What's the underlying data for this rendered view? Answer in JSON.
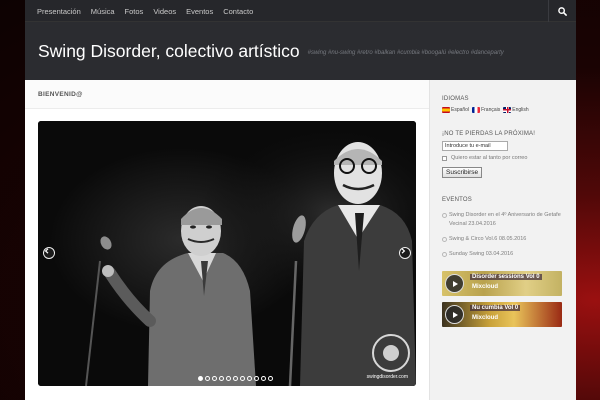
{
  "nav": {
    "items": [
      "Presentación",
      "Música",
      "Fotos",
      "Videos",
      "Eventos",
      "Contacto"
    ]
  },
  "header": {
    "title": "Swing Disorder, colectivo artístico",
    "tagline": "#swing #nu-swing #retro #balkan #cumbia #boogalú #electro #danceparty"
  },
  "main": {
    "page_title": "BIENVENID@",
    "slider": {
      "dot_count": 11,
      "active_dot": 0,
      "watermark": "swingdisorder.com"
    }
  },
  "sidebar": {
    "languages": {
      "title": "IDIOMAS",
      "items": [
        "Español",
        "Français",
        "English"
      ]
    },
    "newsletter": {
      "title": "¡NO TE PIERDAS LA PRÓXIMA!",
      "email_value": "Introduce tu e-mail",
      "checkbox_label": "Quiero estar al tanto por correo",
      "button_label": "Suscribirse"
    },
    "events": {
      "title": "EVENTOS",
      "items": [
        "Swing Disorder en el 4º Aniversario de Getafe Vecinal 23.04.2016",
        "Swing & Circo Vol.6 08.05.2016",
        "Sunday Swing 03.04.2016"
      ]
    },
    "mixes": [
      {
        "name": "Disorder sessions Vol 0",
        "brand": "Mixcloud"
      },
      {
        "name": "Nu cumbia Vol 0",
        "brand": "Mixcloud"
      }
    ]
  },
  "colors": {
    "nav_bg": "#26272b",
    "header_bg": "#2b2c30",
    "sidebar_bg": "#f2f2f2",
    "link_text": "#7d7d7d"
  }
}
